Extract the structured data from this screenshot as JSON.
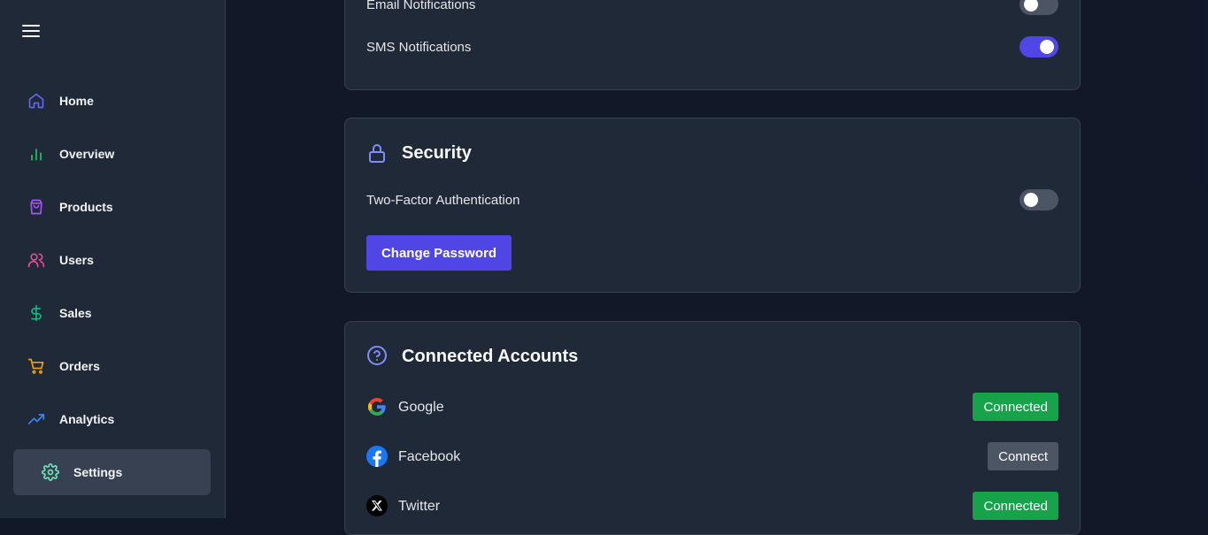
{
  "sidebar": {
    "items": [
      {
        "label": "Home",
        "icon": "home-icon",
        "color": "#6366f1"
      },
      {
        "label": "Overview",
        "icon": "bar-chart-icon",
        "color": "#22c55e"
      },
      {
        "label": "Products",
        "icon": "shopping-bag-icon",
        "color": "#a855f7"
      },
      {
        "label": "Users",
        "icon": "users-icon",
        "color": "#ec4899"
      },
      {
        "label": "Sales",
        "icon": "dollar-icon",
        "color": "#10b981"
      },
      {
        "label": "Orders",
        "icon": "cart-icon",
        "color": "#f59e0b"
      },
      {
        "label": "Analytics",
        "icon": "trending-up-icon",
        "color": "#3b82f6"
      },
      {
        "label": "Settings",
        "icon": "gear-icon",
        "color": "#6ee7b7"
      }
    ],
    "active": "Settings"
  },
  "notifications": {
    "email_label": "Email Notifications",
    "email_enabled": false,
    "sms_label": "SMS Notifications",
    "sms_enabled": true
  },
  "security": {
    "title": "Security",
    "two_factor_label": "Two-Factor Authentication",
    "two_factor_enabled": false,
    "change_password_label": "Change Password"
  },
  "connected_accounts": {
    "title": "Connected Accounts",
    "accounts": [
      {
        "name": "Google",
        "status": "Connected",
        "connected": true
      },
      {
        "name": "Facebook",
        "status": "Connect",
        "connected": false
      },
      {
        "name": "Twitter",
        "status": "Connected",
        "connected": true
      }
    ]
  },
  "colors": {
    "accent": "#4f46e5",
    "connected": "#16a34a",
    "disconnected": "#4b5563"
  }
}
